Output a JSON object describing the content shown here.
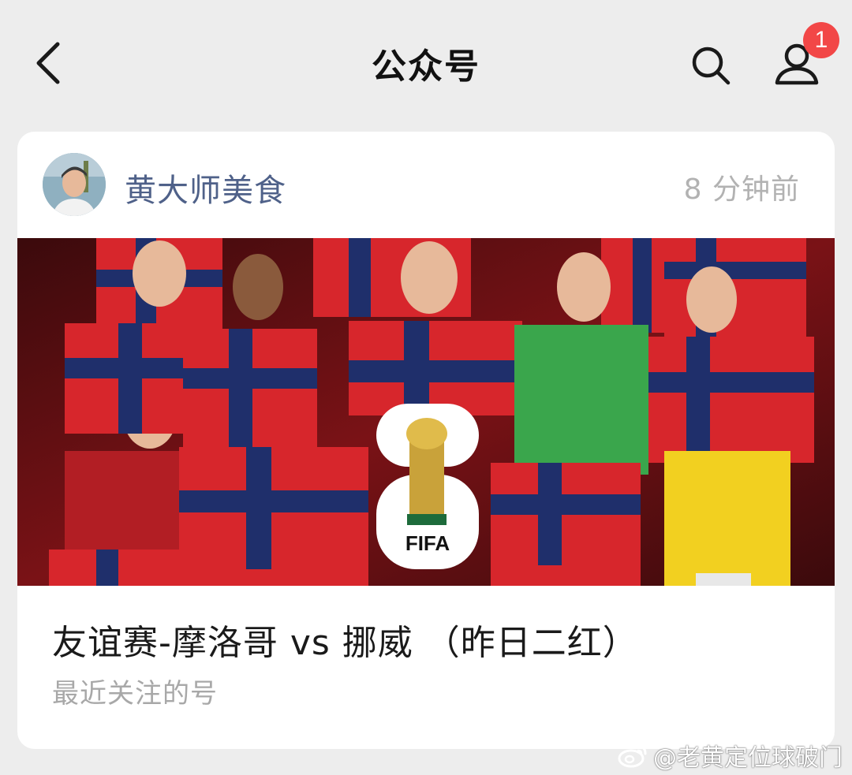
{
  "header": {
    "title": "公众号",
    "back_icon": "chevron-left-icon",
    "search_icon": "search-icon",
    "profile_icon": "user-icon",
    "notification_count": "1"
  },
  "post": {
    "account_name": "黄大师美食",
    "time": "8 分钟前",
    "cover_text": "FIFA",
    "title": "友谊赛-摩洛哥 vs 挪威 （昨日二红）",
    "subtitle": "最近关注的号"
  },
  "watermark": {
    "text": "@老黄定位球破门"
  },
  "colors": {
    "background": "#ededed",
    "card": "#ffffff",
    "account_name": "#4f6189",
    "badge": "#f24747",
    "muted": "#a8a8a8",
    "jersey_red": "#d7262c",
    "jersey_navy": "#1f2f6b",
    "keeper_green": "#3aa64c",
    "keeper_yellow": "#f2d020"
  }
}
